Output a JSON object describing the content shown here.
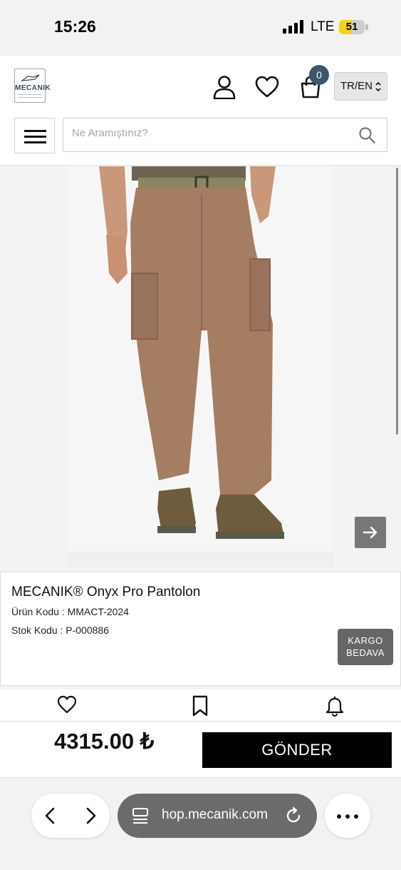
{
  "status_bar": {
    "time": "15:26",
    "network": "LTE",
    "battery": "51",
    "battery_level": 0.51
  },
  "header": {
    "logo_text": "MECANIK",
    "cart_count": "0",
    "language": "TR/EN",
    "search_placeholder": "Ne Aramıştınız?"
  },
  "product": {
    "title": "MECANIK® Onyx Pro Pantolon",
    "code_line": "Ürün Kodu : MMACT-2024",
    "stock_line": "Stok Kodu : P-000886",
    "badge_line1": "KARGO",
    "badge_line2": "BEDAVA",
    "price": "4315.00 ₺",
    "send_label": "GÖNDER"
  },
  "browser": {
    "url": "hop.mecanik.com"
  },
  "icons": {
    "user": "user-icon",
    "favorites": "heart-icon",
    "cart": "bag-icon",
    "search": "search-icon",
    "next": "arrow-right-icon",
    "bookmark": "bookmark-icon",
    "notify": "bell-icon"
  },
  "colors": {
    "badge_bg": "#3f5568",
    "send_bg": "#000000",
    "kargo_bg": "#666666",
    "battery": "#f5d21b"
  }
}
